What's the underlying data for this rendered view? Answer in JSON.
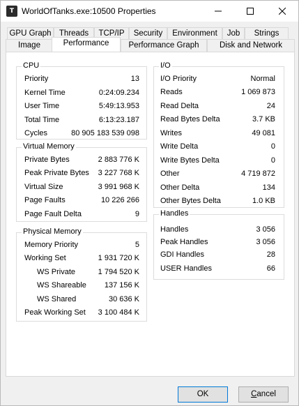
{
  "window": {
    "title": "WorldOfTanks.exe:10500 Properties",
    "app_icon_glyph": "T"
  },
  "tabs_row1": [
    "GPU Graph",
    "Threads",
    "TCP/IP",
    "Security",
    "Environment",
    "Job",
    "Strings"
  ],
  "tabs_row2": [
    "Image",
    "Performance",
    "Performance Graph",
    "Disk and Network"
  ],
  "active_tab": "Performance",
  "cpu": {
    "title": "CPU",
    "rows": [
      {
        "label": "Priority",
        "value": "13"
      },
      {
        "label": "Kernel Time",
        "value": "0:24:09.234"
      },
      {
        "label": "User Time",
        "value": "5:49:13.953"
      },
      {
        "label": "Total Time",
        "value": "6:13:23.187"
      },
      {
        "label": "Cycles",
        "value": "80 905 183 539 098"
      }
    ]
  },
  "virtual_memory": {
    "title": "Virtual Memory",
    "rows": [
      {
        "label": "Private Bytes",
        "value": "2 883 776 K"
      },
      {
        "label": "Peak Private Bytes",
        "value": "3 227 768 K"
      },
      {
        "label": "Virtual Size",
        "value": "3 991 968 K"
      },
      {
        "label": "Page Faults",
        "value": "10 226 266"
      },
      {
        "label": "Page Fault Delta",
        "value": "9"
      }
    ]
  },
  "physical_memory": {
    "title": "Physical Memory",
    "rows": [
      {
        "label": "Memory Priority",
        "value": "5"
      },
      {
        "label": "Working Set",
        "value": "1 931 720 K"
      },
      {
        "label": "WS Private",
        "value": "1 794 520 K"
      },
      {
        "label": "WS Shareable",
        "value": "137 156 K"
      },
      {
        "label": "WS Shared",
        "value": "30 636 K"
      },
      {
        "label": "Peak Working Set",
        "value": "3 100 484 K"
      }
    ]
  },
  "io": {
    "title": "I/O",
    "rows": [
      {
        "label": "I/O Priority",
        "value": "Normal"
      },
      {
        "label": "Reads",
        "value": "1 069 873"
      },
      {
        "label": "Read Delta",
        "value": "24"
      },
      {
        "label": "Read Bytes Delta",
        "value": "3.7  KB"
      },
      {
        "label": "Writes",
        "value": "49 081"
      },
      {
        "label": "Write Delta",
        "value": "0"
      },
      {
        "label": "Write Bytes Delta",
        "value": "0"
      },
      {
        "label": "Other",
        "value": "4 719 872"
      },
      {
        "label": "Other Delta",
        "value": "134"
      },
      {
        "label": "Other Bytes Delta",
        "value": "1.0  KB"
      }
    ]
  },
  "handles": {
    "title": "Handles",
    "rows": [
      {
        "label": "Handles",
        "value": "3 056"
      },
      {
        "label": "Peak Handles",
        "value": "3 056"
      },
      {
        "label": "GDI Handles",
        "value": "28"
      },
      {
        "label": "USER Handles",
        "value": "66"
      }
    ]
  },
  "buttons": {
    "ok": "OK",
    "cancel_prefix": "",
    "cancel_underlined": "C",
    "cancel_rest": "ancel"
  }
}
